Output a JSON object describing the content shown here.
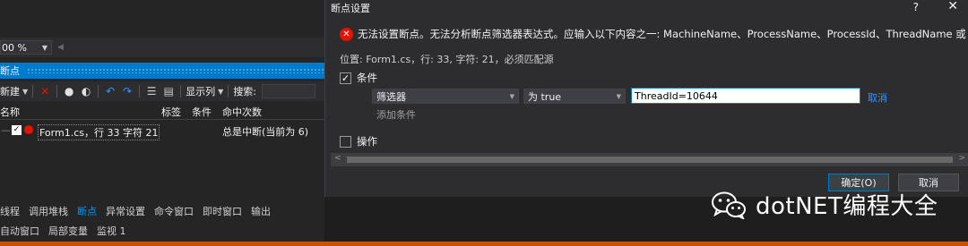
{
  "vs": {
    "zoom": "00 %",
    "panel_title": "断点",
    "toolbar": {
      "new_label": "新建",
      "columns_label": "显示列",
      "search_label": "搜索:"
    },
    "columns": [
      "名称",
      "标签",
      "条件",
      "命中次数"
    ],
    "row": {
      "name": "Form1.cs，行 33 字符 21",
      "hits": "总是中断(当前为 6)"
    },
    "tabs1": [
      "线程",
      "调用堆栈",
      "断点",
      "异常设置",
      "命令窗口",
      "即时窗口",
      "输出"
    ],
    "tabs2": [
      "自动窗口",
      "局部变量",
      "监视 1"
    ]
  },
  "dialog": {
    "title": "断点设置",
    "help": "?",
    "close": "✕",
    "error_text": "无法设置断点。无法分析断点筛选器表达式。应输入以下内容之一: MachineName、ProcessName、ProcessId、ThreadName 或 Threa",
    "location": "位置: Form1.cs，行: 33, 字符: 21，必须匹配源",
    "conditions_label": "条件",
    "conditions_checked": true,
    "condition_type": "筛选器",
    "condition_op": "为 true",
    "expression": "ThreadId=10644",
    "cancel_link": "取消",
    "add_condition": "添加条件",
    "actions_label": "操作",
    "actions_checked": false,
    "ok_button": "确定(O)",
    "cancel_button": "取消"
  },
  "watermark": {
    "text": "dotNET编程大全",
    "icon": "wechat-icon"
  },
  "colors": {
    "accent": "#007acc",
    "error": "#e51400",
    "link": "#3794ff",
    "status_bar": "#ca5100"
  }
}
